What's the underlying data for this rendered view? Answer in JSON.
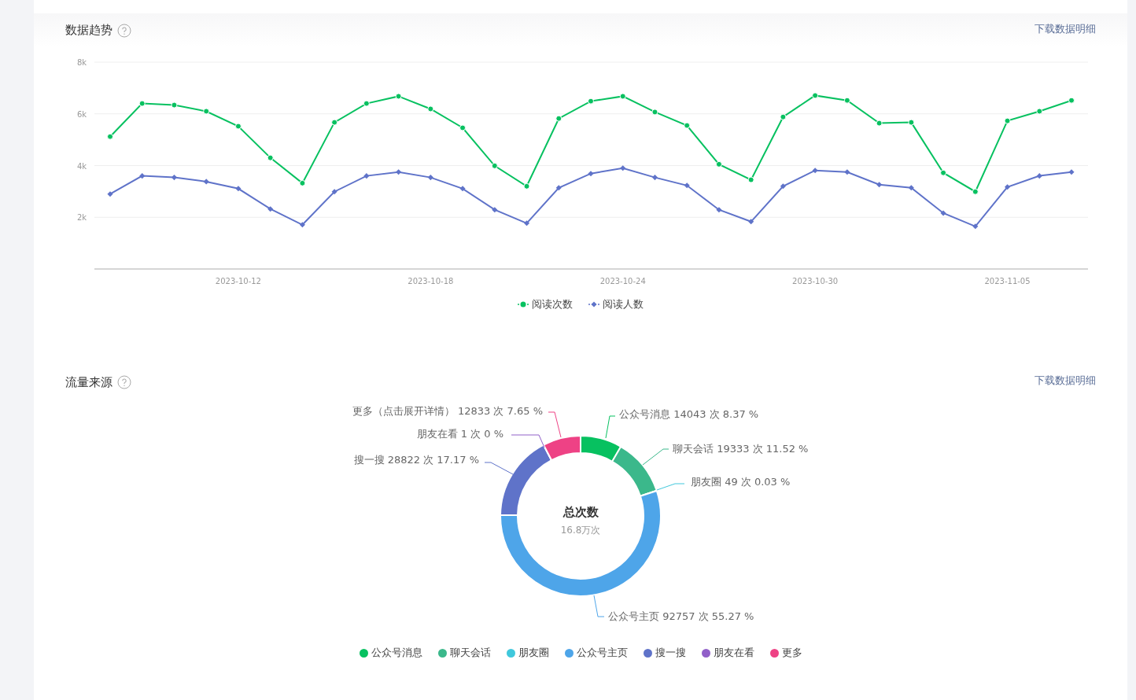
{
  "sections": [
    {
      "title": "数据趋势",
      "help": true,
      "download_link": "下载数据明细",
      "chart_data": {
        "type": "line",
        "legend": "bottom",
        "grid": "y",
        "categories": [
          null,
          null,
          null,
          null,
          "2023-10-12",
          null,
          null,
          null,
          null,
          null,
          "2023-10-18",
          null,
          null,
          null,
          null,
          null,
          "2023-10-24",
          null,
          null,
          null,
          null,
          null,
          "2023-10-30",
          null,
          null,
          null,
          null,
          null,
          "2023-11-05",
          null,
          null
        ],
        "ylim": [
          0,
          8000
        ],
        "yticks": [
          {
            "value": 2000,
            "label": "2k"
          },
          {
            "value": 4000,
            "label": "4k"
          },
          {
            "value": 6000,
            "label": "6k"
          },
          {
            "value": 8000,
            "label": "8k"
          }
        ],
        "series": [
          {
            "name": "阅读次数",
            "color": "#07c160",
            "marker": "circle",
            "values": [
              5120,
              6400,
              6340,
              6100,
              5520,
              4300,
              3320,
              5670,
              6400,
              6680,
              6190,
              5460,
              3990,
              3200,
              5820,
              6490,
              6680,
              6070,
              5550,
              4050,
              3450,
              5880,
              6710,
              6520,
              5640,
              5670,
              3720,
              2990,
              5730,
              6100,
              6520
            ]
          },
          {
            "name": "阅读人数",
            "color": "#5f73c9",
            "marker": "diamond",
            "values": [
              2900,
              3600,
              3540,
              3380,
              3110,
              2320,
              1710,
              2990,
              3600,
              3750,
              3540,
              3110,
              2290,
              1770,
              3140,
              3690,
              3900,
              3540,
              3230,
              2290,
              1830,
              3200,
              3810,
              3750,
              3260,
              3140,
              2160,
              1650,
              3170,
              3600,
              3750
            ]
          }
        ]
      }
    },
    {
      "title": "流量来源",
      "help": true,
      "download_link": "下载数据明细",
      "center_title": "总次数",
      "center_value": "16.8万次",
      "chart_data": {
        "type": "donut",
        "legend": "bottom",
        "categories": [
          "公众号消息",
          "聊天会话",
          "朋友圈",
          "公众号主页",
          "搜一搜",
          "朋友在看",
          "更多"
        ],
        "values": [
          14043,
          19333,
          49,
          92757,
          28822,
          1,
          12833
        ],
        "colors": [
          "#07c160",
          "#3bb88b",
          "#40c8dc",
          "#4ea5e9",
          "#5f73c9",
          "#9160c9",
          "#ee4285"
        ],
        "value_labels": [
          "公众号消息 14043 次 8.37 %",
          "聊天会话 19333 次 11.52 %",
          "朋友圈 49 次 0.03 %",
          "公众号主页 92757 次 55.27 %",
          "搜一搜 28822 次 17.17 %",
          "朋友在看 1 次 0 %",
          "更多（点击展开详情） 12833 次 7.65 %"
        ]
      }
    }
  ]
}
